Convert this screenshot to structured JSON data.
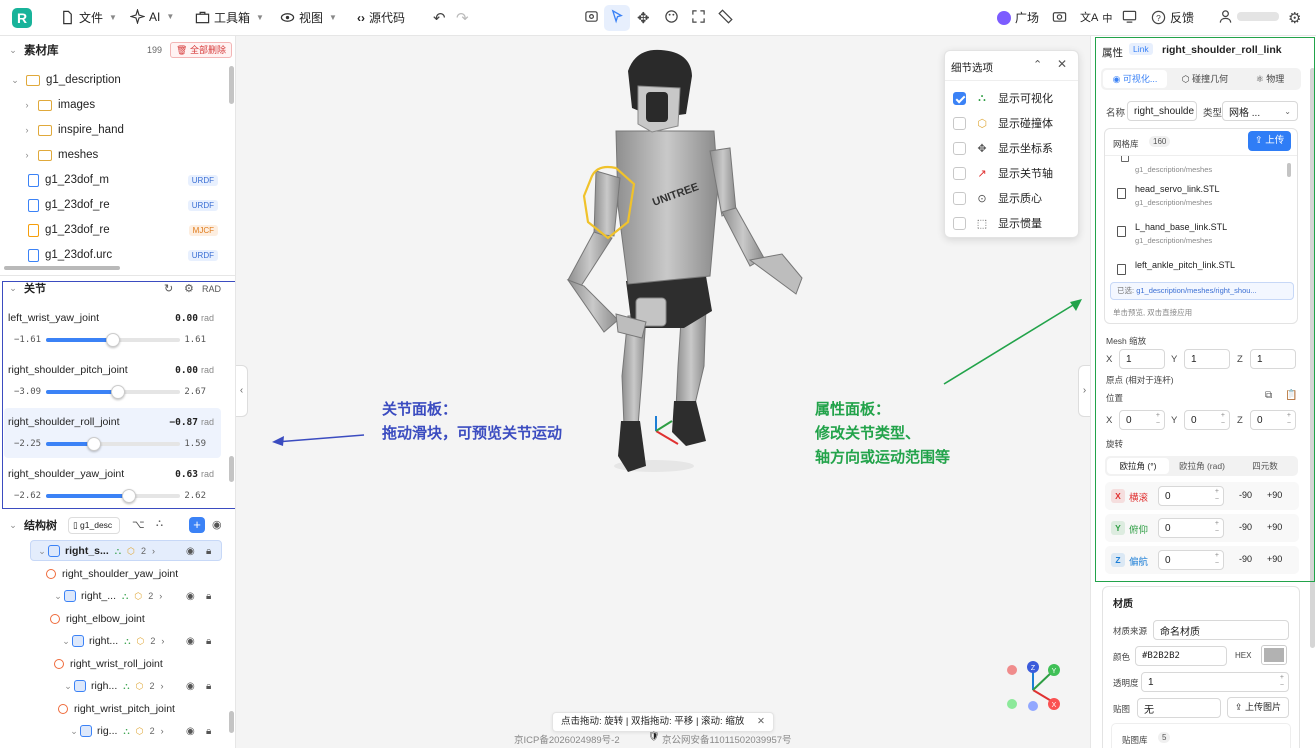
{
  "topbar": {
    "file": "文件",
    "ai": "AI",
    "toolbox": "工具箱",
    "view": "视图",
    "source": "源代码",
    "plaza": "广场",
    "lang": "中",
    "feedback": "反馈"
  },
  "assets": {
    "title": "素材库",
    "count": "199",
    "delete_all": "全部删除",
    "items": [
      {
        "name": "g1_description",
        "kind": "folder",
        "tag": ""
      },
      {
        "name": "images",
        "kind": "folder",
        "tag": ""
      },
      {
        "name": "inspire_hand",
        "kind": "folder",
        "tag": ""
      },
      {
        "name": "meshes",
        "kind": "folder",
        "tag": ""
      },
      {
        "name": "g1_23dof_m",
        "kind": "file",
        "tag": "URDF"
      },
      {
        "name": "g1_23dof_re",
        "kind": "file",
        "tag": "URDF"
      },
      {
        "name": "g1_23dof_re",
        "kind": "file",
        "tag": "MJCF"
      },
      {
        "name": "g1_23dof.urc",
        "kind": "file",
        "tag": "URDF"
      }
    ]
  },
  "joints": {
    "title": "关节",
    "unit_toggle": "RAD",
    "items": [
      {
        "name": "left_wrist_yaw_joint",
        "value": "0.00",
        "unit": "rad",
        "min": "−1.61",
        "max": "1.61",
        "fraction": 0.5
      },
      {
        "name": "right_shoulder_pitch_joint",
        "value": "0.00",
        "unit": "rad",
        "min": "−3.09",
        "max": "2.67",
        "fraction": 0.536
      },
      {
        "name": "right_shoulder_roll_joint",
        "value": "−0.87",
        "unit": "rad",
        "min": "−2.25",
        "max": "1.59",
        "fraction": 0.36
      },
      {
        "name": "right_shoulder_yaw_joint",
        "value": "0.63",
        "unit": "rad",
        "min": "−2.62",
        "max": "2.62",
        "fraction": 0.62
      }
    ]
  },
  "tree": {
    "title": "结构树",
    "robot": "g1_desc",
    "rows": [
      {
        "name": "right_s...",
        "kind": "link",
        "count": "2"
      },
      {
        "name": "right_shoulder_yaw_joint",
        "kind": "joint"
      },
      {
        "name": "right_...",
        "kind": "link",
        "count": "2"
      },
      {
        "name": "right_elbow_joint",
        "kind": "joint"
      },
      {
        "name": "right...",
        "kind": "link",
        "count": "2"
      },
      {
        "name": "right_wrist_roll_joint",
        "kind": "joint"
      },
      {
        "name": "righ...",
        "kind": "link",
        "count": "2"
      },
      {
        "name": "right_wrist_pitch_joint",
        "kind": "joint"
      },
      {
        "name": "rig...",
        "kind": "link",
        "count": "2"
      }
    ]
  },
  "detail": {
    "title": "细节选项",
    "options": [
      {
        "label": "显示可视化",
        "checked": true
      },
      {
        "label": "显示碰撞体",
        "checked": false
      },
      {
        "label": "显示坐标系",
        "checked": false
      },
      {
        "label": "显示关节轴",
        "checked": false
      },
      {
        "label": "显示质心",
        "checked": false
      },
      {
        "label": "显示惯量",
        "checked": false
      }
    ]
  },
  "annotations": {
    "joint_panel": [
      "关节面板：",
      "拖动滑块，可预览关节运动"
    ],
    "prop_panel": [
      "属性面板：",
      "修改关节类型、",
      "轴方向或运动范围等"
    ]
  },
  "robot_chest": "UNITREE",
  "hint": "点击拖动: 旋转 | 双指拖动: 平移 | 滚动: 缩放",
  "footer": {
    "icp": "京ICP备2026024989号-2",
    "police": "京公网安备11011502039957号"
  },
  "props": {
    "title": "属性",
    "badge": "Link",
    "link_name": "right_shoulder_roll_link",
    "tabs": [
      "可视化...",
      "碰撞几何",
      "物理"
    ],
    "name_label": "名称",
    "name_value": "right_shoulde",
    "type_label": "类型",
    "type_value": "网格 ...",
    "mesh_lib": "网格库",
    "mesh_count": "160",
    "upload": "上传",
    "mesh_items": [
      {
        "name": "head_servo_link.STL",
        "path": "g1_description/meshes"
      },
      {
        "name": "L_hand_base_link.STL",
        "path": "g1_description/meshes"
      },
      {
        "name": "left_ankle_pitch_link.STL",
        "path": ""
      }
    ],
    "mesh_top_path": "g1_description/meshes",
    "selected_prefix": "已选:",
    "selected_path": "g1_description/meshes/right_shou...",
    "click_hint": "单击预览, 双击直接应用",
    "scale_label": "Mesh 缩放",
    "scale": {
      "x": "1",
      "y": "1",
      "z": "1"
    },
    "origin_label": "原点 (相对于连杆)",
    "position_label": "位置",
    "position": {
      "x": "0",
      "y": "0",
      "z": "0"
    },
    "rotation_label": "旋转",
    "rot_tabs": [
      "欧拉角 (°)",
      "欧拉角 (rad)",
      "四元数"
    ],
    "rot_rows": [
      {
        "axis": "X",
        "name": "横滚",
        "value": "0",
        "neg": "-90",
        "pos": "+90",
        "color": "#e03131"
      },
      {
        "axis": "Y",
        "name": "俯仰",
        "value": "0",
        "neg": "-90",
        "pos": "+90",
        "color": "#2f9e44"
      },
      {
        "axis": "Z",
        "name": "偏航",
        "value": "0",
        "neg": "-90",
        "pos": "+90",
        "color": "#1c7ed6"
      }
    ],
    "material": {
      "title": "材质",
      "source_label": "材质来源",
      "source_value": "命名材质",
      "color_label": "颜色",
      "color_value": "#B2B2B2",
      "hex": "HEX",
      "opacity_label": "透明度",
      "opacity_value": "1",
      "texture_label": "贴图",
      "texture_value": "无",
      "upload_img": "上传图片",
      "lib_label": "贴图库",
      "lib_count": "5"
    }
  },
  "colors": {
    "accent": "#3b82f6",
    "panel_blue": "#3b4cc0",
    "panel_green": "#22a34a",
    "robot_grey": "#B2B2B2"
  }
}
